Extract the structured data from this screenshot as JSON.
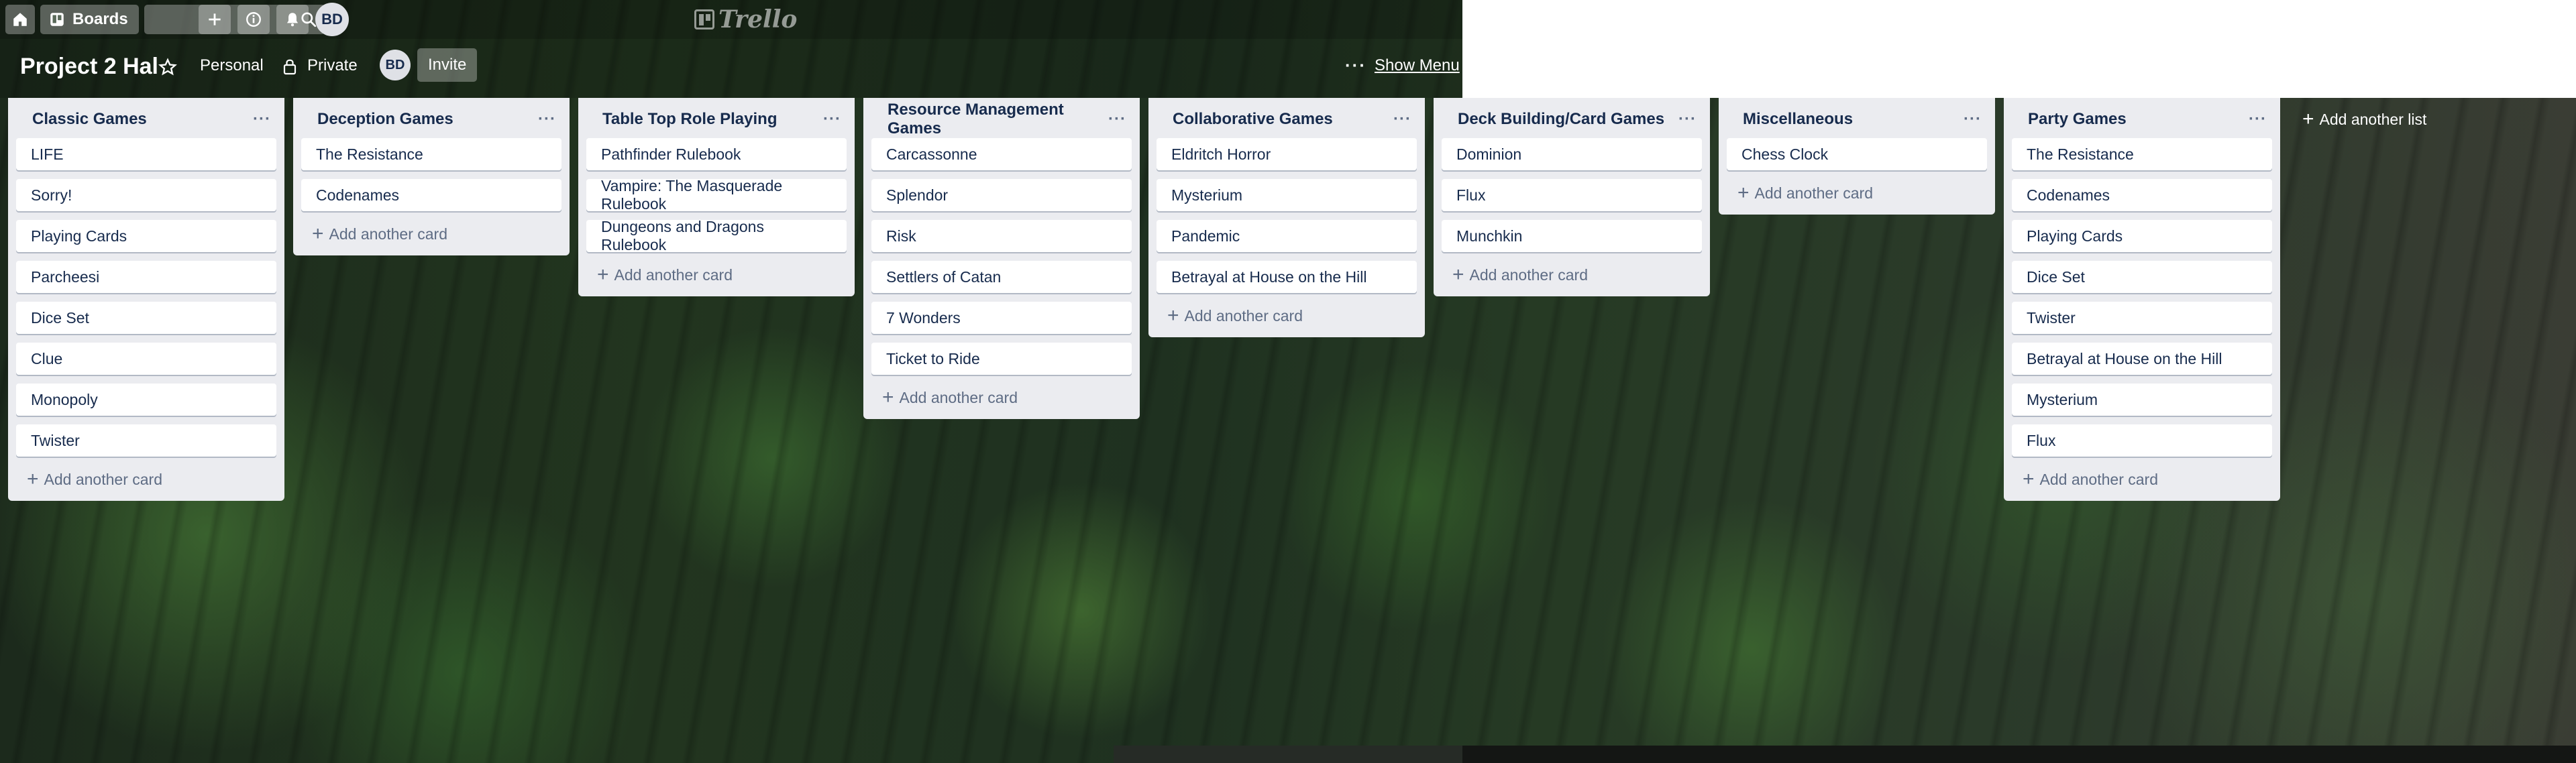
{
  "header": {
    "boards_label": "Boards",
    "logo_text": "Trello",
    "avatar_initials": "BD"
  },
  "board": {
    "title": "Project 2 Hal",
    "visibility_team": "Personal",
    "visibility_privacy": "Private",
    "member_initials": "BD",
    "invite_label": "Invite",
    "show_menu_label": "Show Menu"
  },
  "lists": [
    {
      "title": "Classic Games",
      "cards": [
        "LIFE",
        "Sorry!",
        "Playing Cards",
        "Parcheesi",
        "Dice Set",
        "Clue",
        "Monopoly",
        "Twister"
      ]
    },
    {
      "title": "Deception Games",
      "cards": [
        "The Resistance",
        "Codenames"
      ]
    },
    {
      "title": "Table Top Role Playing",
      "cards": [
        "Pathfinder Rulebook",
        "Vampire: The Masquerade Rulebook",
        "Dungeons and Dragons Rulebook"
      ]
    },
    {
      "title": "Resource Management Games",
      "cards": [
        "Carcassonne",
        "Splendor",
        "Risk",
        "Settlers of Catan",
        "7 Wonders",
        "Ticket to Ride"
      ]
    },
    {
      "title": "Collaborative Games",
      "cards": [
        "Eldritch Horror",
        "Mysterium",
        "Pandemic",
        "Betrayal at House on the Hill"
      ]
    },
    {
      "title": "Deck Building/Card Games",
      "cards": [
        "Dominion",
        "Flux",
        "Munchkin"
      ]
    },
    {
      "title": "Miscellaneous",
      "cards": [
        "Chess Clock"
      ]
    },
    {
      "title": "Party Games",
      "cards": [
        "The Resistance",
        "Codenames",
        "Playing Cards",
        "Dice Set",
        "Twister",
        "Betrayal at House on the Hill",
        "Mysterium",
        "Flux"
      ]
    }
  ],
  "add_card_label": "Add another card",
  "list_menu_glyph": "···",
  "add_list_label": "Add another list",
  "icons": {
    "home": "home-icon",
    "boards": "boards-icon",
    "search": "search-icon",
    "create": "plus-icon",
    "info": "info-icon",
    "notifications": "bell-icon",
    "star": "star-icon",
    "lock": "lock-icon",
    "more": "ellipsis-icon"
  },
  "colors": {
    "list_bg": "#ebecf0",
    "card_bg": "#ffffff",
    "text": "#172b4d",
    "muted": "#5e6c84"
  }
}
